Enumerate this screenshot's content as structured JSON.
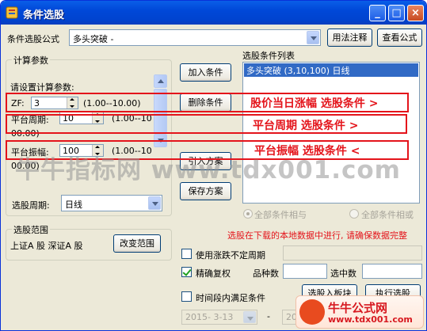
{
  "window": {
    "title": "条件选股"
  },
  "formula": {
    "label": "条件选股公式",
    "selected": "多头突破  -",
    "usage_btn": "用法注释",
    "view_btn": "查看公式"
  },
  "calc": {
    "group_title": "计算参数",
    "prompt": "请设置计算参数:",
    "params": [
      {
        "label": "ZF:",
        "value": "3",
        "range": "(1.00--10.00)"
      },
      {
        "label": "平台周期:",
        "value": "10",
        "range": "(1.00--10",
        "range2": "00.00)"
      },
      {
        "label": "平台振幅:",
        "value": "100",
        "range": "(1.00--10",
        "range2": "00.00)"
      }
    ],
    "period_label": "选股周期:",
    "period_value": "日线"
  },
  "buttons": {
    "add": "加入条件",
    "delete": "删除条件",
    "load": "引入方案",
    "save": "保存方案"
  },
  "list": {
    "title": "选股条件列表",
    "items": [
      "多头突破  (3,10,100)  日线"
    ]
  },
  "logic": {
    "all_and": "全部条件相与",
    "all_or": "全部条件相或"
  },
  "scope": {
    "group_title": "选股范围",
    "markets": "上证A 股  深证A 股",
    "change_btn": "改变范围"
  },
  "notice": "选股在下载的本地数据中进行, 请确保数据完整",
  "options": {
    "use_period": "使用涨跌不定周期",
    "exact_adjust": "精确复权",
    "kinds_label": "品种数",
    "selected_label": "选中数",
    "time_condition": "时间段内满足条件",
    "date_from": "2015- 3-13",
    "date_to": "20",
    "to_sep": "-",
    "to_board_btn": "选股入板块",
    "run_btn": "执行选股"
  },
  "annotations": {
    "a1": "股价当日涨幅  选股条件 >",
    "a2": "平台周期  选股条件 >",
    "a3": "平台振幅  选股条件 <"
  },
  "watermark": "牛牛指标网 www.tdx001.com",
  "logo": {
    "name": "牛牛公式网",
    "url": "www.tdx001.com"
  },
  "colors": {
    "title_bar": "#0048d8",
    "annotation": "#e4141b",
    "selection": "#316ac5"
  }
}
